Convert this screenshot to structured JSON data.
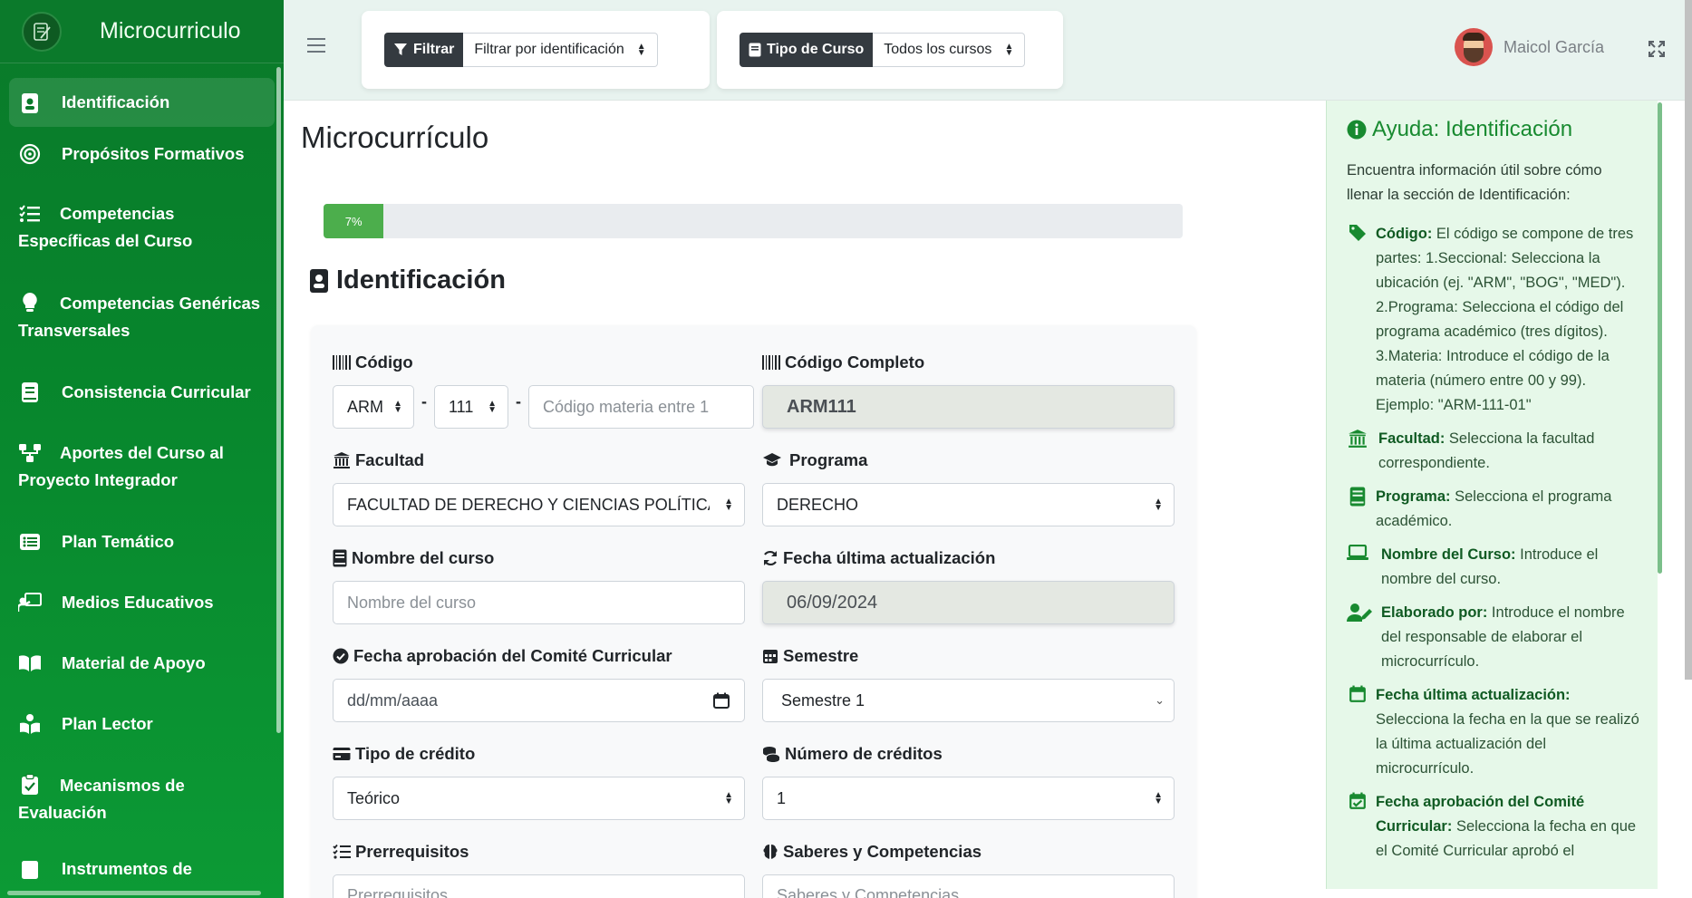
{
  "brand": {
    "title": "Microcurriculo"
  },
  "sidebar": {
    "items": [
      {
        "label": "Identificación",
        "icon": "id-badge-icon",
        "active": true
      },
      {
        "label": "Propósitos Formativos",
        "icon": "target-icon"
      },
      {
        "label": "Competencias Específicas del Curso",
        "icon": "list-check-icon"
      },
      {
        "label": "Competencias Genéricas Transversales",
        "icon": "lightbulb-icon"
      },
      {
        "label": "Consistencia Curricular",
        "icon": "book-icon"
      },
      {
        "label": "Aportes del Curso al Proyecto Integrador",
        "icon": "diagram-icon"
      },
      {
        "label": "Plan Temático",
        "icon": "list-alt-icon"
      },
      {
        "label": "Medios Educativos",
        "icon": "chalkboard-teacher-icon"
      },
      {
        "label": "Material de Apoyo",
        "icon": "open-book-icon"
      },
      {
        "label": "Plan Lector",
        "icon": "book-reader-icon"
      },
      {
        "label": "Mecanismos de Evaluación",
        "icon": "clipboard-check-icon"
      },
      {
        "label": "Instrumentos de",
        "icon": "clipboard-icon"
      }
    ]
  },
  "topbar": {
    "filter": {
      "label": "Filtrar",
      "value": "Filtrar por identificación"
    },
    "course_type": {
      "label": "Tipo de Curso",
      "value": "Todos los cursos"
    },
    "user_name": "Maicol García"
  },
  "main": {
    "title": "Microcurrículo",
    "progress": {
      "percent": 7,
      "label": "7%"
    },
    "section_title": "Identificación"
  },
  "form": {
    "codigo": {
      "label": "Código",
      "seccional": "ARM",
      "programa": "111",
      "materia_placeholder": "Código materia entre 1"
    },
    "codigo_completo": {
      "label": "Código Completo",
      "value": "ARM111"
    },
    "facultad": {
      "label": "Facultad",
      "value": "FACULTAD DE DERECHO Y CIENCIAS POLÍTICAS Y"
    },
    "programa": {
      "label": "Programa",
      "value": "DERECHO"
    },
    "nombre_curso": {
      "label": "Nombre del curso",
      "placeholder": "Nombre del curso"
    },
    "fecha_actualizacion": {
      "label": "Fecha última actualización",
      "value": "06/09/2024"
    },
    "fecha_aprobacion": {
      "label": "Fecha aprobación del Comité Curricular",
      "placeholder": "dd/mm/aaaa"
    },
    "semestre": {
      "label": "Semestre",
      "value": "Semestre 1"
    },
    "tipo_credito": {
      "label": "Tipo de crédito",
      "value": "Teórico"
    },
    "numero_creditos": {
      "label": "Número de créditos",
      "value": "1"
    },
    "prerrequisitos": {
      "label": "Prerrequisitos",
      "placeholder": "Prerrequisitos"
    },
    "saberes": {
      "label": "Saberes y Competencias",
      "placeholder": "Saberes y Competencias"
    }
  },
  "help": {
    "title": "Ayuda: Identificación",
    "intro": "Encuentra información útil sobre cómo llenar la sección de Identificación:",
    "items": [
      {
        "icon": "tag-icon",
        "term": "Código:",
        "text": " El código se compone de tres partes: 1.Seccional: Selecciona la ubicación (ej. \"ARM\", \"BOG\", \"MED\"). 2.Programa: Selecciona el código del programa académico (tres dígitos). 3.Materia: Introduce el código de la materia (número entre 00 y 99). Ejemplo: \"ARM-111-01\""
      },
      {
        "icon": "university-icon",
        "term": "Facultad:",
        "text": " Selecciona la facultad correspondiente."
      },
      {
        "icon": "book-icon",
        "term": "Programa:",
        "text": " Selecciona el programa académico."
      },
      {
        "icon": "laptop-icon",
        "term": "Nombre del Curso:",
        "text": " Introduce el nombre del curso."
      },
      {
        "icon": "user-edit-icon",
        "term": "Elaborado por:",
        "text": " Introduce el nombre del responsable de elaborar el microcurrículo."
      },
      {
        "icon": "calendar-icon",
        "term": "Fecha última actualización:",
        "text": " Selecciona la fecha en la que se realizó la última actualización del microcurrículo."
      },
      {
        "icon": "calendar-check-icon",
        "term": "Fecha aprobación del Comité Curricular:",
        "text": " Selecciona la fecha en que el Comité Curricular aprobó el"
      }
    ]
  },
  "colors": {
    "sidebar": "#0a7a2a",
    "accent": "#188a30",
    "help_bg": "#e6f8e9",
    "progress": "#4cae4c"
  }
}
